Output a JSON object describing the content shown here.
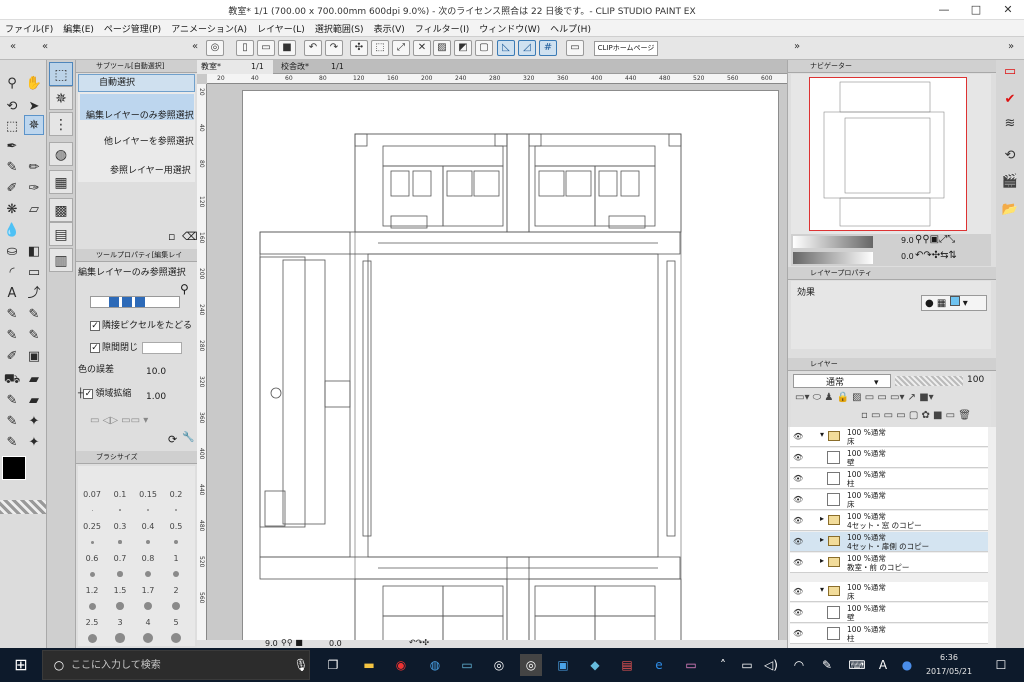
{
  "window": {
    "title": "教室* 1/1 (700.00 x 700.00mm 600dpi 9.0%)  - 次のライセンス照合は 22 日後です。- CLIP STUDIO PAINT EX",
    "min": "—",
    "max": "□",
    "close": "✕"
  },
  "menu": [
    "ファイル(F)",
    "編集(E)",
    "ページ管理(P)",
    "アニメーション(A)",
    "レイヤー(L)",
    "選択範囲(S)",
    "表示(V)",
    "フィルター(I)",
    "ウィンドウ(W)",
    "ヘルプ(H)"
  ],
  "command_bar": {
    "clip_button": "CLIPホームページ"
  },
  "sub_tool": {
    "tab": "サブツール[自動選択]",
    "header": "自動選択",
    "items": [
      "編集レイヤーのみ参照選択",
      "他レイヤーを参照選択",
      "参照レイヤー用選択"
    ]
  },
  "tool_property": {
    "tab": "ツールプロパティ[編集レイ",
    "title": "編集レイヤーのみ参照選択",
    "adjacent_label": "隣接ピクセルをたどる",
    "gap_label": "隙間閉じ",
    "tolerance_label": "色の誤差",
    "tolerance_value": "10.0",
    "expand_label": "領域拡縮",
    "expand_value": "1.00"
  },
  "brush_size": {
    "tab": "ブラシサイズ",
    "values": [
      "0.07",
      "0.1",
      "0.15",
      "0.2",
      "0.25",
      "0.3",
      "0.4",
      "0.5",
      "0.6",
      "0.7",
      "0.8",
      "1",
      "1.2",
      "1.5",
      "1.7",
      "2",
      "2.5",
      "3",
      "4",
      "5"
    ]
  },
  "document_tabs": [
    {
      "name": "教室*",
      "page": "1/1"
    },
    {
      "name": "校舎改*",
      "page": "1/1"
    }
  ],
  "ruler_labels": [
    "20",
    "40",
    "60",
    "80",
    "120",
    "160",
    "200",
    "240",
    "280",
    "320",
    "360",
    "400",
    "440",
    "480",
    "520",
    "560",
    "600"
  ],
  "vruler_labels": [
    "20",
    "40",
    "80",
    "120",
    "160",
    "200",
    "240",
    "280",
    "320",
    "360",
    "400",
    "440",
    "480",
    "520",
    "560"
  ],
  "canvas_status": {
    "zoom": "9.0",
    "angle": "0.0"
  },
  "navigator": {
    "tab": "ナビゲーター",
    "zoom": "9.0",
    "angle": "0.0"
  },
  "layer_property": {
    "tab": "レイヤープロパティ",
    "effect_label": "効果"
  },
  "layers_panel": {
    "tab": "レイヤー",
    "blend_mode": "通常",
    "opacity": "100",
    "layers": [
      {
        "opacity": "100 %通常",
        "name": "床",
        "type": "folder-open"
      },
      {
        "opacity": "100 %通常",
        "name": "壁",
        "type": "raster"
      },
      {
        "opacity": "100 %通常",
        "name": "柱",
        "type": "raster"
      },
      {
        "opacity": "100 %通常",
        "name": "床",
        "type": "raster"
      },
      {
        "opacity": "100 %通常",
        "name": "4セット・窓 のコピー",
        "type": "folder"
      },
      {
        "opacity": "100 %通常",
        "name": "4セット・扉側 のコピー",
        "type": "folder",
        "highlight": true
      },
      {
        "opacity": "100 %通常",
        "name": "教室・前 のコピー",
        "type": "folder"
      },
      {
        "opacity": "100 %通常",
        "name": "床",
        "type": "folder-open"
      },
      {
        "opacity": "100 %通常",
        "name": "壁",
        "type": "raster"
      },
      {
        "opacity": "100 %通常",
        "name": "柱",
        "type": "raster"
      }
    ]
  },
  "taskbar": {
    "search_placeholder": "ここに入力して検索",
    "time": "6:36",
    "date": "2017/05/21"
  }
}
